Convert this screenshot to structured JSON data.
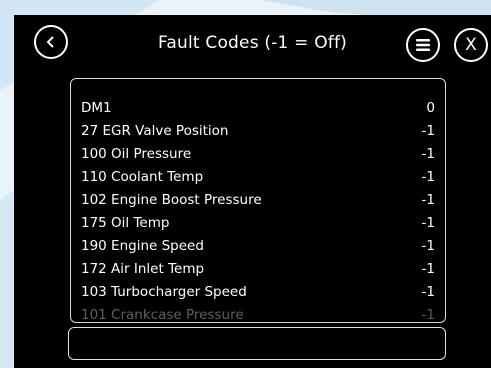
{
  "title": "Fault Codes (-1 = Off)",
  "header": {
    "back_icon": "back-arrow-icon",
    "menu_icon": "hamburger-menu-icon",
    "close_label": "X"
  },
  "fault_codes": [
    {
      "label": "DM1",
      "value": "0"
    },
    {
      "label": "27 EGR Valve Position",
      "value": "-1"
    },
    {
      "label": "100 Oil Pressure",
      "value": "-1"
    },
    {
      "label": "110 Coolant Temp",
      "value": "-1"
    },
    {
      "label": "102 Engine Boost Pressure",
      "value": "-1"
    },
    {
      "label": "175 Oil Temp",
      "value": "-1"
    },
    {
      "label": "190 Engine Speed",
      "value": "-1"
    },
    {
      "label": "172 Air Inlet Temp",
      "value": "-1"
    },
    {
      "label": "103 Turbocharger Speed",
      "value": "-1"
    },
    {
      "label": "101 Crankcase Pressure",
      "value": "-1"
    }
  ],
  "input": {
    "value": ""
  },
  "colors": {
    "screen_bg": "#000000",
    "text": "#ffffff",
    "faded_text": "#5f5f5f",
    "page_bg": "#eaf3f9"
  }
}
